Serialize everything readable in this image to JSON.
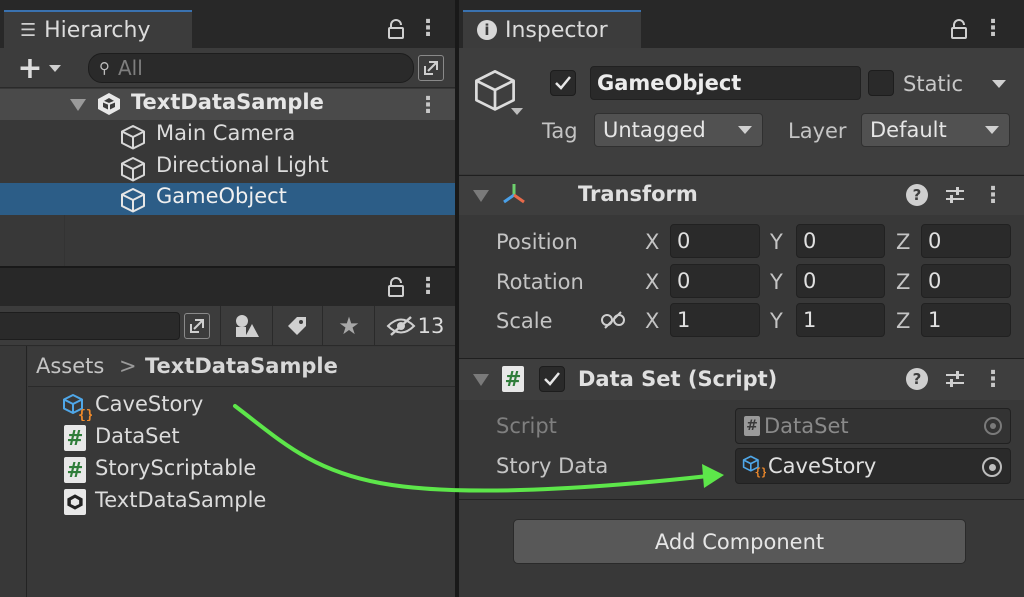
{
  "hierarchy": {
    "tab_label": "Hierarchy",
    "search_placeholder": "All",
    "scene_name": "TextDataSample",
    "items": [
      {
        "label": "Main Camera"
      },
      {
        "label": "Directional Light"
      },
      {
        "label": "GameObject",
        "selected": true
      }
    ]
  },
  "project": {
    "filter_count": "13",
    "breadcrumb_root": "Assets",
    "breadcrumb_sep": ">",
    "breadcrumb_folder": "TextDataSample",
    "assets": [
      {
        "label": "CaveStory",
        "icon": "scriptable-object-icon"
      },
      {
        "label": "DataSet",
        "icon": "csharp-script-icon"
      },
      {
        "label": "StoryScriptable",
        "icon": "csharp-script-icon"
      },
      {
        "label": "TextDataSample",
        "icon": "unity-scene-icon"
      }
    ]
  },
  "inspector": {
    "tab_label": "Inspector",
    "object_name": "GameObject",
    "static_label": "Static",
    "tag_label": "Tag",
    "tag_value": "Untagged",
    "layer_label": "Layer",
    "layer_value": "Default",
    "transform": {
      "title": "Transform",
      "rows": [
        {
          "label": "Position",
          "x": "0",
          "y": "0",
          "z": "0"
        },
        {
          "label": "Rotation",
          "x": "0",
          "y": "0",
          "z": "0"
        },
        {
          "label": "Scale",
          "x": "1",
          "y": "1",
          "z": "1"
        }
      ],
      "axis_x": "X",
      "axis_y": "Y",
      "axis_z": "Z"
    },
    "dataset": {
      "title": "Data Set (Script)",
      "script_label": "Script",
      "script_value": "DataSet",
      "story_label": "Story Data",
      "story_value": "CaveStory"
    },
    "add_component_label": "Add Component"
  },
  "colors": {
    "selection": "#2c5d87",
    "arrow": "#5de64a",
    "script_green": "#4caf50"
  }
}
